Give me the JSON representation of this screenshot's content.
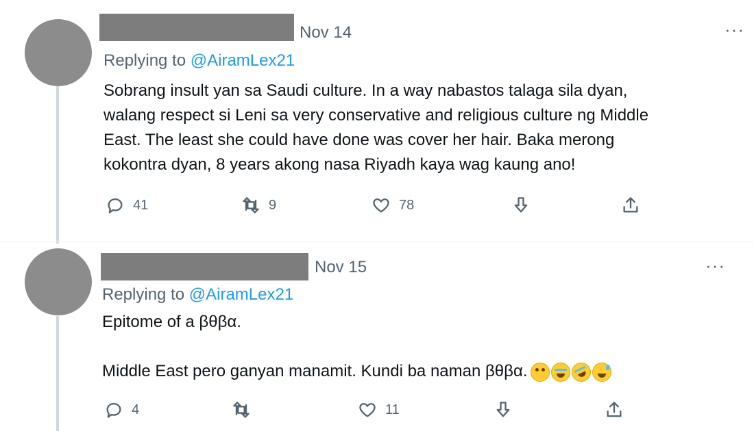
{
  "tweets": [
    {
      "date": "Nov 14",
      "more_label": "···",
      "replying_prefix": "Replying to ",
      "replying_handle": "@AiramLex21",
      "text": "Sobrang insult yan sa Saudi culture. In a way nabastos talaga sila dyan,\nwalang respect si Leni sa very conservative and religious culture ng Middle\nEast. The least she could have done was cover her hair. Baka merong\nkokontra dyan, 8 years akong nasa Riyadh kaya wag kaung ano!",
      "reply_count": "41",
      "retweet_count": "9",
      "like_count": "78"
    },
    {
      "date": "Nov 15",
      "more_label": "···",
      "replying_prefix": "Replying to ",
      "replying_handle": "@AiramLex21",
      "text": "Epitome of a βθβα.\n\nMiddle East pero ganyan manamit. Kundi ba naman βθβα.",
      "emojis": [
        "face-with-rolling-eyes",
        "face-with-tears-of-joy",
        "rolling-on-floor-laughing",
        "grinning-face-with-sweat"
      ],
      "reply_count": "4",
      "retweet_count": "",
      "like_count": "11"
    }
  ],
  "icons": {
    "reply": "reply-icon",
    "retweet": "retweet-icon",
    "like": "like-icon",
    "downvote": "downvote-icon",
    "share": "share-icon",
    "more": "more-icon"
  },
  "colors": {
    "text": "#0f1419",
    "secondary": "#536471",
    "mention": "#1d9bf0",
    "thread_line": "#cfd9de",
    "redaction": "#7d7d7d",
    "avatar": "#8c8c8c"
  }
}
